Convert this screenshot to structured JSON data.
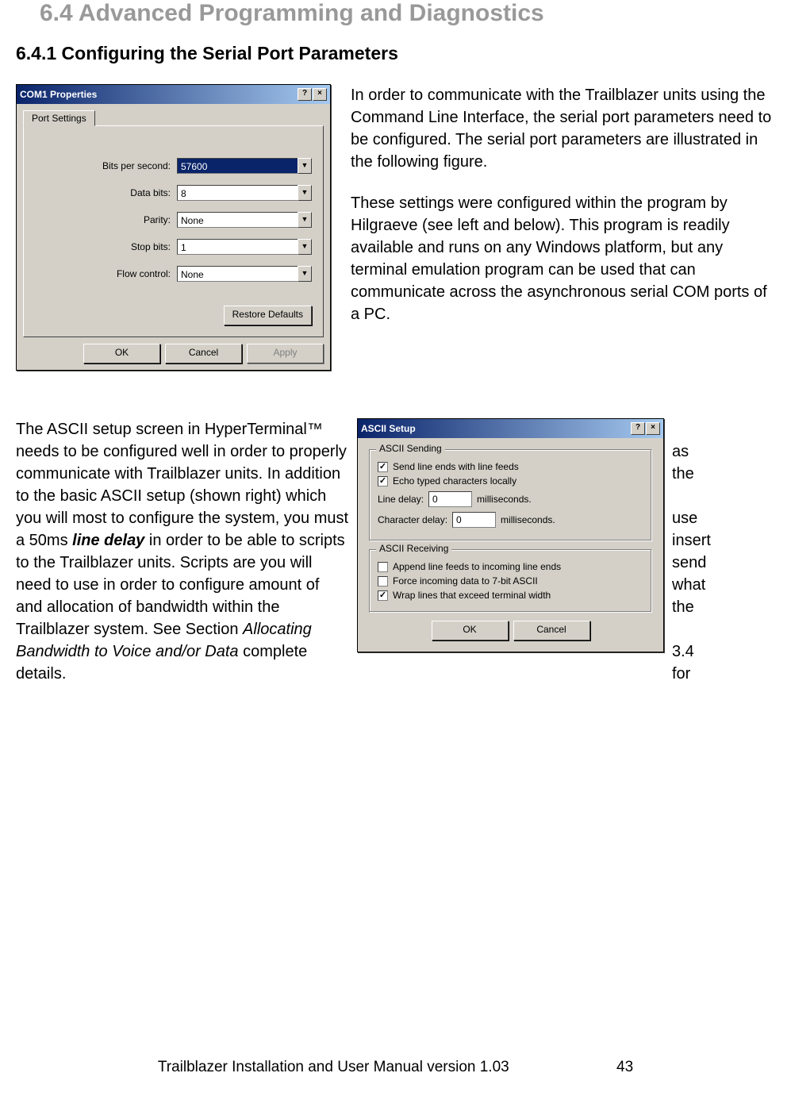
{
  "heading_section": "6.4  Advanced Programming and Diagnostics",
  "heading_subsection": "6.4.1  Configuring the Serial Port Parameters",
  "para1": "In order to communicate with the Trailblazer units using the Command Line Interface, the serial port parameters need to be configured. The serial port parameters are illustrated in the following figure.",
  "para2": "These settings were configured within the program by Hilgraeve (see left and below). This program is readily available and runs on any Windows platform, but any terminal emulation program can be used that can communicate across the asynchronous serial COM ports of a PC.",
  "para3_left_pre": "The ASCII setup screen in HyperTerminal™ needs to be configured well in order to properly communicate with Trailblazer units. In addition to the basic ASCII setup (shown right) which you will most to configure the system, you must a 50ms ",
  "para3_bold": "line delay",
  "para3_left_post": " in order to be able to scripts to the Trailblazer units. Scripts are you will need to use in order to configure amount of and allocation of bandwidth within the Trailblazer system. See Section ",
  "para3_italic": "Allocating Bandwidth to Voice and/or Data",
  "para3_end": " complete details.",
  "right_words": "\nas\nthe\n\nuse\ninsert\nsend\nwhat\nthe\n\n3.4\nfor",
  "footer_text": "Trailblazer Installation and User Manual version 1.03",
  "footer_page": "43",
  "dialog1": {
    "title": "COM1 Properties",
    "tab": "Port Settings",
    "fields": {
      "bps_label": "Bits per second:",
      "bps_value": "57600",
      "databits_label": "Data bits:",
      "databits_value": "8",
      "parity_label": "Parity:",
      "parity_value": "None",
      "stopbits_label": "Stop bits:",
      "stopbits_value": "1",
      "flow_label": "Flow control:",
      "flow_value": "None"
    },
    "restore": "Restore Defaults",
    "ok": "OK",
    "cancel": "Cancel",
    "apply": "Apply"
  },
  "dialog2": {
    "title": "ASCII Setup",
    "group1": {
      "title": "ASCII Sending",
      "cb1": "Send line ends with line feeds",
      "cb2": "Echo typed characters locally",
      "line_delay_label": "Line delay:",
      "line_delay_value": "0",
      "char_delay_label": "Character delay:",
      "char_delay_value": "0",
      "ms": "milliseconds."
    },
    "group2": {
      "title": "ASCII Receiving",
      "cb1": "Append line feeds to incoming line ends",
      "cb2": "Force incoming data to 7-bit ASCII",
      "cb3": "Wrap lines that exceed terminal width"
    },
    "ok": "OK",
    "cancel": "Cancel"
  }
}
